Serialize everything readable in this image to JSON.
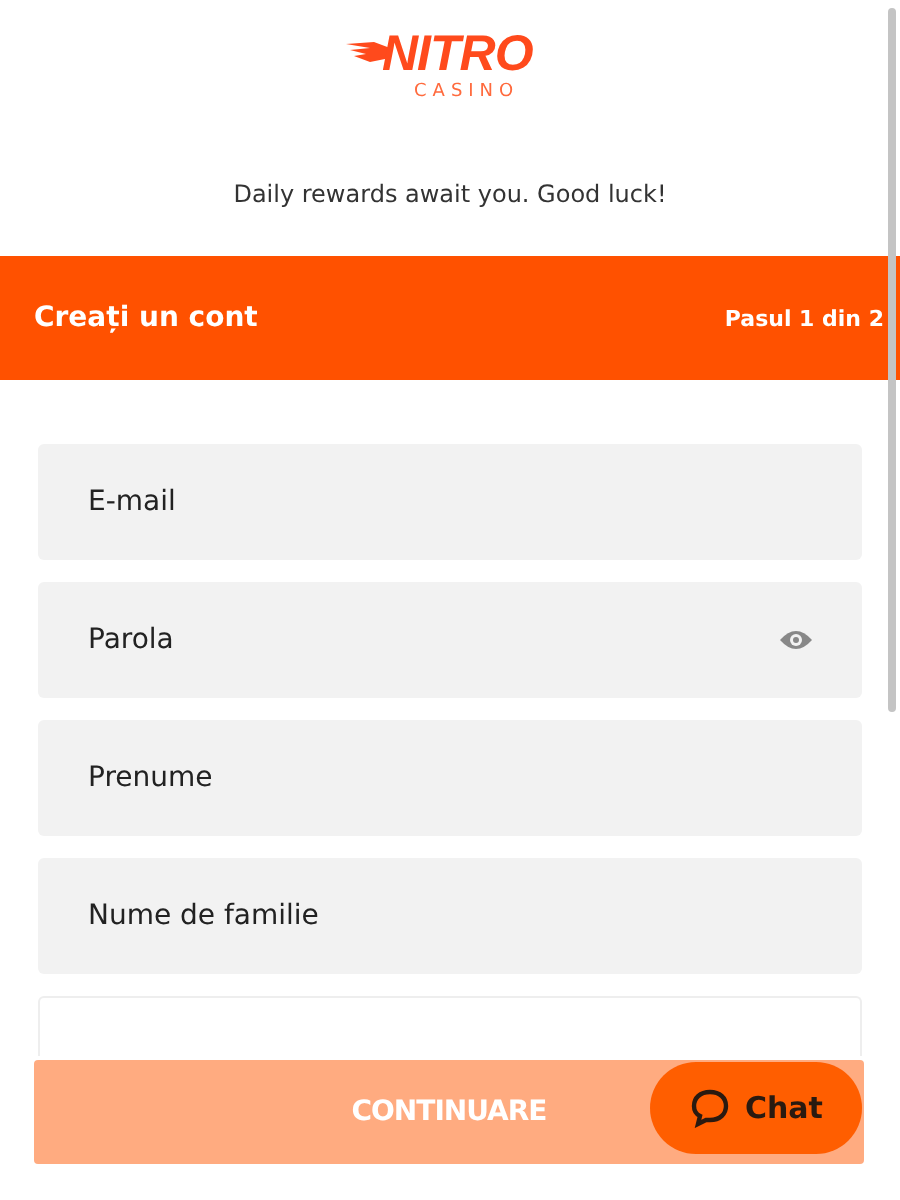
{
  "logo": {
    "name": "NITRO",
    "subtitle": "CASINO"
  },
  "tagline": "Daily rewards await you. Good luck!",
  "header": {
    "title": "Creați un cont",
    "step": "Pasul 1 din 2"
  },
  "fields": [
    {
      "kind": "text",
      "placeholder": "E-mail"
    },
    {
      "kind": "password",
      "placeholder": "Parola"
    },
    {
      "kind": "text",
      "placeholder": "Prenume"
    },
    {
      "kind": "text",
      "placeholder": "Nume de familie"
    }
  ],
  "continue_button": {
    "label": "CONTINUARE",
    "disabled": true
  },
  "chat_button": {
    "label": "Chat"
  }
}
